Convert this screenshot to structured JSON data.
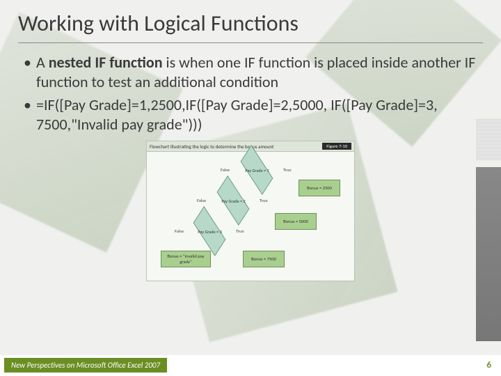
{
  "title": "Working with Logical Functions",
  "bullets": {
    "b1_prefix": "A ",
    "b1_bold": "nested IF function",
    "b1_rest": " is when one IF function is placed inside another IF function to test an additional condition",
    "b2": "=IF([Pay Grade]=1,2500,IF([Pay Grade]=2,5000, IF([Pay Grade]=3, 7500,\"Invalid pay grade\")))"
  },
  "figure": {
    "caption": "Flowchart illustrating the logic to determine the bonus amount",
    "badge": "Figure 7-10",
    "labels": {
      "false": "False",
      "true": "True"
    },
    "nodes": {
      "d1": "Pay Grade = 1",
      "d2": "Pay Grade = 2",
      "d3": "Pay Grade = 3",
      "r1": "Bonus = 2500",
      "r2": "Bonus = 5000",
      "r3": "Bonus = 7500",
      "r4": "Bonus = \"Invalid pay grade\""
    }
  },
  "footer": {
    "text": "New Perspectives on Microsoft Office Excel 2007",
    "page": "6"
  }
}
